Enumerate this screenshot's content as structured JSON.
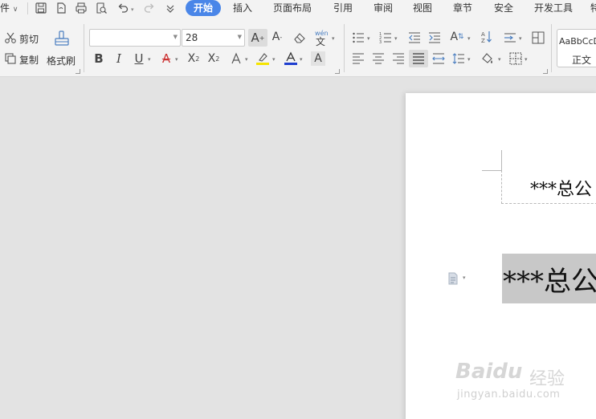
{
  "menubar": {
    "file_partial": "件",
    "tabs": [
      "开始",
      "插入",
      "页面布局",
      "引用",
      "审阅",
      "视图",
      "章节",
      "安全",
      "开发工具",
      "特"
    ]
  },
  "clipboard": {
    "cut": "剪切",
    "copy": "复制",
    "format_painter": "格式刷"
  },
  "font": {
    "name": "",
    "size": "28"
  },
  "styles": {
    "preview": "AaBbCcDd",
    "normal": "正文"
  },
  "document": {
    "header_text": "***总公",
    "body_text": "***总公"
  },
  "watermark": {
    "brand": "Baidu",
    "cn": "经验",
    "url": "jingyan.baidu.com"
  }
}
